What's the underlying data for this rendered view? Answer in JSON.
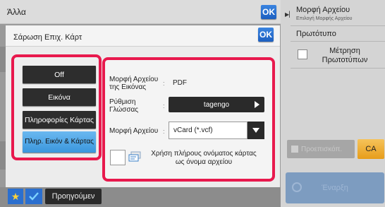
{
  "background": {
    "title": "Άλλα",
    "ok_label": "OK",
    "right_panel": {
      "title": "Μορφή Αρχείου",
      "subtitle": "Επιλογή Μορφής Αρχείου",
      "original": "Πρωτότυπο",
      "count_originals": "Μέτρηση Πρωτοτύπων",
      "preview": "Προεπισκόπ.",
      "ca": "CA",
      "start": "Έναρξη"
    },
    "bottom": {
      "prev_label": "Προηγούμεν"
    }
  },
  "dialog": {
    "title": "Σάρωση Επιχ. Κάρτ",
    "ok_label": "OK",
    "options": [
      {
        "label": "Off"
      },
      {
        "label": "Εικόνα"
      },
      {
        "label": "Πληροφορίες Κάρτας"
      },
      {
        "label": "Πληρ. Εικόν & Κάρτας",
        "selected": true
      }
    ],
    "image_format_label": "Μορφή Αρχείου της Εικόνας",
    "image_format_value": "PDF",
    "language_label": "Ρύθμιση Γλώσσας",
    "language_value": "tagengo",
    "file_format_label": "Μορφή Αρχείου",
    "file_format_value": "vCard (*.vcf)",
    "use_full_name_label": "Χρήση πλήρους ονόματος κάρτας ως όνομα αρχείου",
    "use_full_name_checked": false
  },
  "colors": {
    "highlight": "#e8194d",
    "ok_blue": "#2b6fcf",
    "selected_option": "#4aa6e6"
  }
}
